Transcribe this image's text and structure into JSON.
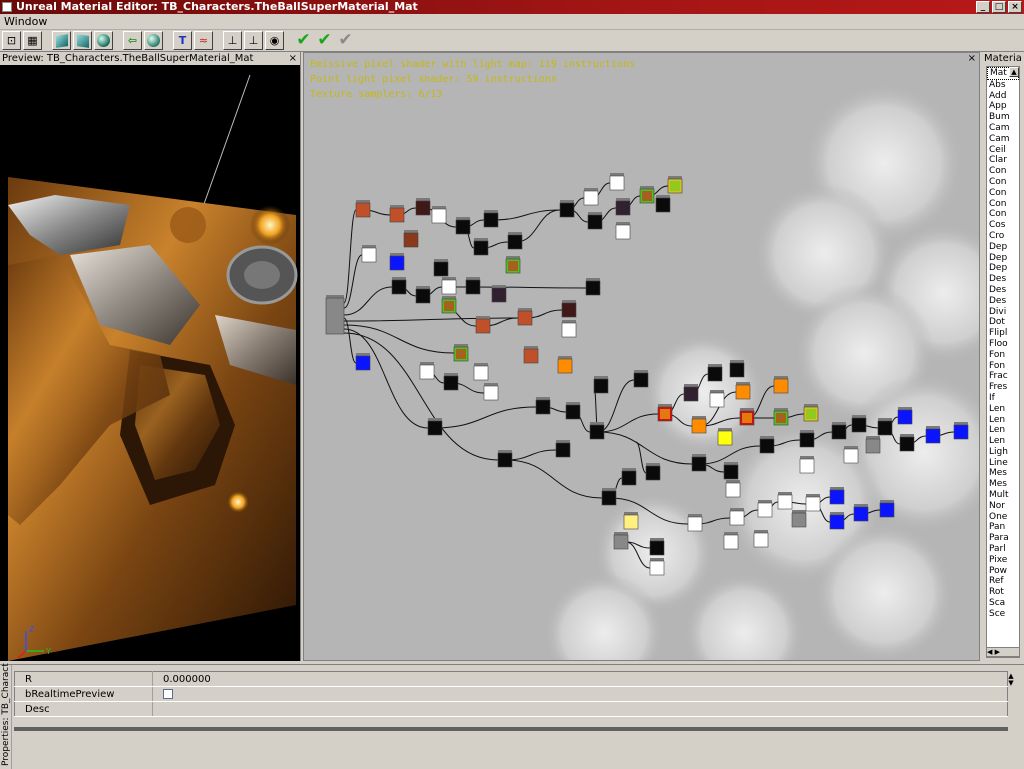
{
  "window": {
    "title": "Unreal Material Editor: TB_Characters.TheBallSuperMaterial_Mat",
    "minimize": "_",
    "maximize": "□",
    "close": "×"
  },
  "menu": {
    "items": [
      "Window"
    ]
  },
  "preview": {
    "title": "Preview: TB_Characters.TheBallSuperMaterial_Mat",
    "close": "×",
    "axis_z": "Z",
    "axis_y": "Y"
  },
  "graph": {
    "close": "×",
    "stats": [
      "Emissive pixel shader with light map: 119 instructions",
      "Point light pixel shader: 59 instructions",
      "Texture samplers: 6/13"
    ]
  },
  "materials_panel": {
    "title": "Materia",
    "selected": "Mat",
    "items": [
      "Abs",
      "Add",
      "App",
      "Bum",
      "Cam",
      "Cam",
      "Ceil",
      "Clar",
      "Con",
      "Con",
      "Con",
      "Con",
      "Con",
      "Cos",
      "Cro",
      "Dep",
      "Dep",
      "Dep",
      "Des",
      "Des",
      "Des",
      "Divi",
      "Dot",
      "Flipl",
      "Floo",
      "Fon",
      "Fon",
      "Frac",
      "Fres",
      "If",
      "Len",
      "Len",
      "Len",
      "Len",
      "Ligh",
      "Line",
      "Mes",
      "Mes",
      "Mult",
      "Nor",
      "One",
      "Pan",
      "Para",
      "Parl",
      "Pixe",
      "Pow",
      "Ref",
      "Rot",
      "Sca",
      "Sce"
    ],
    "scroll_up": "▲",
    "scroll_down": "▼",
    "h_scroll": "◀ ▶"
  },
  "properties": {
    "panel_title": "Properties: TB_Charact",
    "close": "×",
    "rows": [
      {
        "key": "R",
        "value": "0.000000"
      },
      {
        "key": "bRealtimePreview",
        "value": ""
      },
      {
        "key": "Desc",
        "value": ""
      }
    ]
  },
  "colors": {
    "titlebar_start": "#6b0a0a",
    "titlebar_end": "#b81818",
    "stats_text": "#c4b816",
    "graph_bg": "#b5b5b5",
    "chrome": "#d4d0c8"
  }
}
